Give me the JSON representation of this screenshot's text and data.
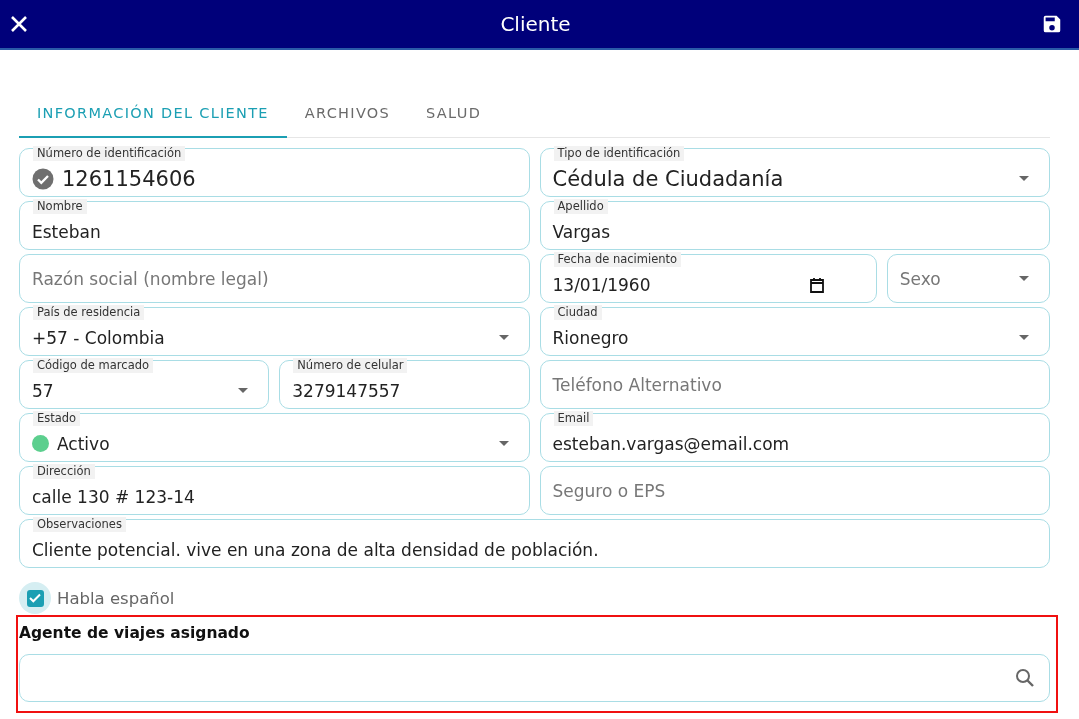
{
  "header": {
    "title": "Cliente"
  },
  "tabs": [
    {
      "label": "INFORMACIÓN DEL CLIENTE",
      "selected": true
    },
    {
      "label": "ARCHIVOS",
      "selected": false
    },
    {
      "label": "SALUD",
      "selected": false
    }
  ],
  "form": {
    "rows": [
      {
        "cells": [
          [
            {
              "kind": "text",
              "label": "Número de identificación",
              "value": "1261154606",
              "verified": true
            }
          ],
          [
            {
              "kind": "select",
              "label": "Tipo de identificación",
              "value": "Cédula de Ciudadanía"
            }
          ]
        ]
      },
      {
        "cells": [
          [
            {
              "kind": "text",
              "label": "Nombre",
              "value": "Esteban"
            }
          ],
          [
            {
              "kind": "text",
              "label": "Apellido",
              "value": "Vargas"
            }
          ]
        ]
      },
      {
        "cells": [
          [
            {
              "kind": "text",
              "placeholder": "Razón social (nombre legal)"
            }
          ],
          [
            {
              "kind": "date",
              "label": "Fecha de nacimiento",
              "value": "13/01/1960"
            },
            {
              "kind": "select",
              "placeholder": "Sexo"
            }
          ]
        ]
      },
      {
        "cells": [
          [
            {
              "kind": "select",
              "label": "País de residencia",
              "value": "+57 - Colombia"
            }
          ],
          [
            {
              "kind": "select",
              "label": "Ciudad",
              "value": "Rionegro"
            }
          ]
        ]
      },
      {
        "cells": [
          [
            {
              "kind": "select",
              "label": "Código de marcado",
              "value": "57"
            },
            {
              "kind": "text",
              "label": "Número de celular",
              "value": "3279147557"
            }
          ],
          [
            {
              "kind": "text",
              "placeholder": "Teléfono Alternativo"
            }
          ]
        ]
      },
      {
        "cells": [
          [
            {
              "kind": "status",
              "label": "Estado",
              "value": "Activo",
              "color": "#5ccf8e"
            }
          ],
          [
            {
              "kind": "text",
              "label": "Email",
              "value": "esteban.vargas@email.com"
            }
          ]
        ]
      },
      {
        "cells": [
          [
            {
              "kind": "text",
              "label": "Dirección",
              "value": "calle 130 # 123-14"
            }
          ],
          [
            {
              "kind": "text",
              "placeholder": "Seguro o EPS"
            }
          ]
        ]
      },
      {
        "cells": [
          [
            {
              "kind": "text",
              "label": "Observaciones",
              "value": "Cliente potencial. vive en una zona de alta densidad de población."
            }
          ]
        ]
      }
    ]
  },
  "checkbox": {
    "label": "Habla español",
    "checked": true
  },
  "agent": {
    "label": "Agente de viajes asignado",
    "highlighted": true
  }
}
